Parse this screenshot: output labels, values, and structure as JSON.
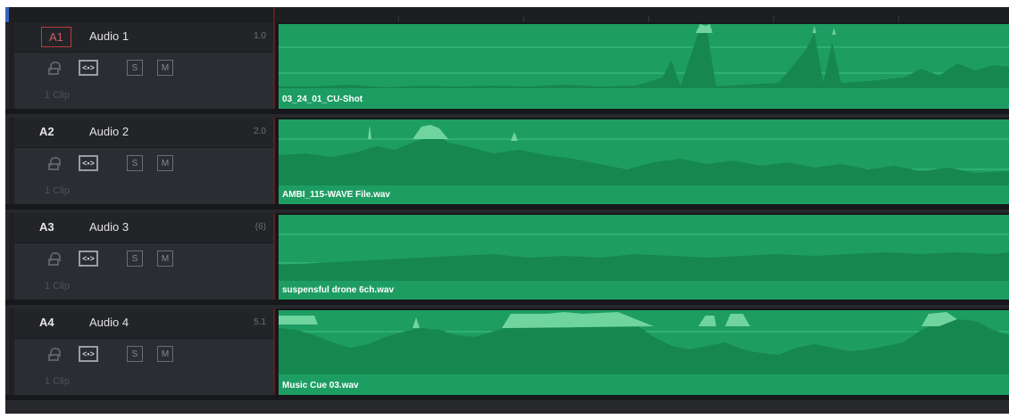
{
  "tracks": [
    {
      "id": "A1",
      "name": "Audio 1",
      "value": "1.0",
      "clips_label": "1 Clip",
      "clip_name": "03_24_01_CU-Shot",
      "selected": true
    },
    {
      "id": "A2",
      "name": "Audio 2",
      "value": "2.0",
      "clips_label": "1 Clip",
      "clip_name": "AMBI_115-WAVE File.wav",
      "selected": false
    },
    {
      "id": "A3",
      "name": "Audio 3",
      "value": "(6)",
      "clips_label": "1 Clip",
      "clip_name": "suspensful drone 6ch.wav",
      "selected": false
    },
    {
      "id": "A4",
      "name": "Audio 4",
      "value": "5.1",
      "clips_label": "1 Clip",
      "clip_name": "Music Cue 03.wav",
      "selected": false
    }
  ],
  "controls": {
    "solo_label": "S",
    "mute_label": "M",
    "link_label": "<•>"
  },
  "icons": [
    "lock-icon",
    "link-icon"
  ],
  "colors": {
    "clip": "#1e9d63",
    "wave_dark": "#16874f",
    "wave_light": "#6fd49e",
    "selected_border": "#b83a3a"
  }
}
